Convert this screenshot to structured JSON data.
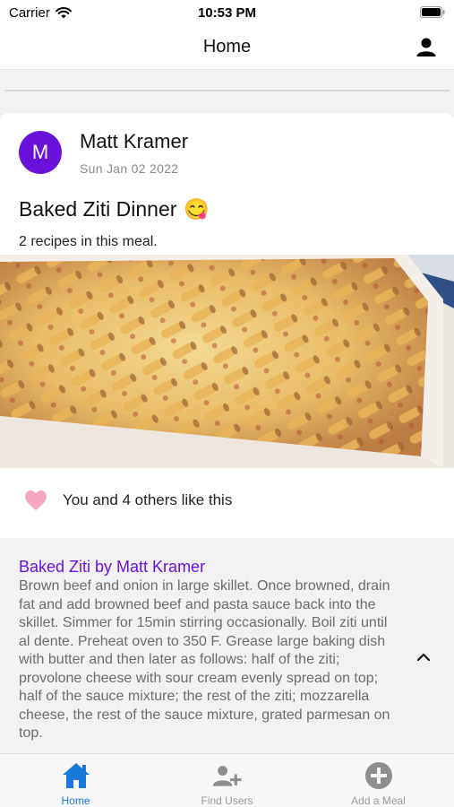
{
  "status_bar": {
    "carrier": "Carrier",
    "time": "10:53 PM"
  },
  "nav": {
    "title": "Home",
    "profile_icon": "person-icon"
  },
  "post": {
    "avatar_letter": "M",
    "author": "Matt Kramer",
    "date": "Sun Jan 02 2022",
    "title": "Baked Ziti Dinner",
    "title_emoji": "😋",
    "recipe_count": "2 recipes in this meal.",
    "likes_text": "You and 4 others like this",
    "recipe": {
      "title": "Baked Ziti by Matt Kramer",
      "body": "Brown beef and onion in large skillet. Once browned, drain fat and add browned beef and pasta sauce back into the skillet. Simmer for 15min stirring occasionally. Boil ziti until al dente. Preheat oven to 350 F. Grease large baking dish with butter and then later as follows: half of the ziti; provolone cheese with sour cream evenly spread on top; half of the sauce mixture; the rest of the ziti; mozzarella cheese, the rest of the sauce mixture, grated parmesan on top."
    }
  },
  "tabs": [
    {
      "label": "Home",
      "icon": "home-icon",
      "active": true
    },
    {
      "label": "Find Users",
      "icon": "add-user-icon",
      "active": false
    },
    {
      "label": "Add a Meal",
      "icon": "add-circle-icon",
      "active": false
    }
  ],
  "colors": {
    "accent": "#6a12d9",
    "tab_active": "#1a7ad9",
    "tab_inactive": "#9a9a9a",
    "heart": "#f7a6c0"
  }
}
